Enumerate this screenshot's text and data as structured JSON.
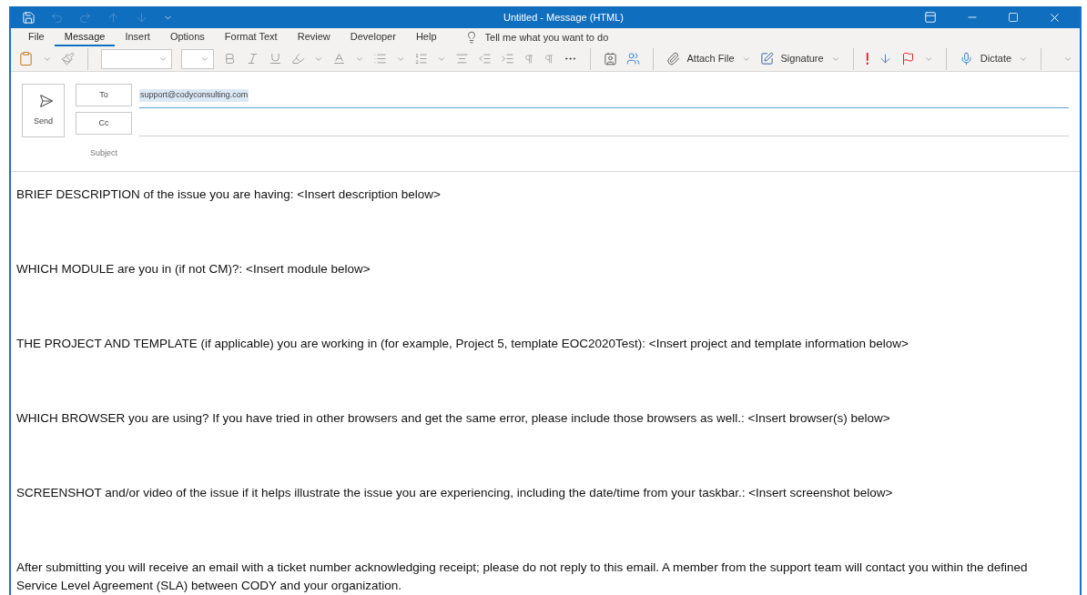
{
  "window": {
    "title": "Untitled  -  Message (HTML)"
  },
  "tabs": [
    {
      "label": "File",
      "selected": false
    },
    {
      "label": "Message",
      "selected": true
    },
    {
      "label": "Insert",
      "selected": false
    },
    {
      "label": "Options",
      "selected": false
    },
    {
      "label": "Format Text",
      "selected": false
    },
    {
      "label": "Review",
      "selected": false
    },
    {
      "label": "Developer",
      "selected": false
    },
    {
      "label": "Help",
      "selected": false
    }
  ],
  "tell_me": {
    "placeholder": "Tell me what you want to do"
  },
  "toolbar": {
    "attach": "Attach File",
    "signature": "Signature",
    "dictate": "Dictate"
  },
  "header": {
    "send": "Send",
    "to_label": "To",
    "to_value": "support@codyconsulting.com",
    "cc_label": "Cc",
    "subject_label": "Subject"
  },
  "body": [
    "BRIEF DESCRIPTION of the issue you are having: <Insert description below>",
    "WHICH MODULE are you in (if not CM)?: <Insert module below>",
    "THE PROJECT AND TEMPLATE (if applicable) you are working in (for example, Project 5, template EOC2020Test): <Insert project and template information below>",
    "WHICH BROWSER you are using? If you have tried in other browsers and get the same error, please include those browsers as well.: <Insert browser(s) below>",
    "SCREENSHOT and/or video of the issue if it helps illustrate the issue you are experiencing, including the date/time from your taskbar.: <Insert screenshot below>",
    "After submitting you will receive an email with a ticket number acknowledging receipt; please do not reply to this email. A member from the support team will contact you within the defined Service Level Agreement (SLA) between CODY and your organization."
  ]
}
